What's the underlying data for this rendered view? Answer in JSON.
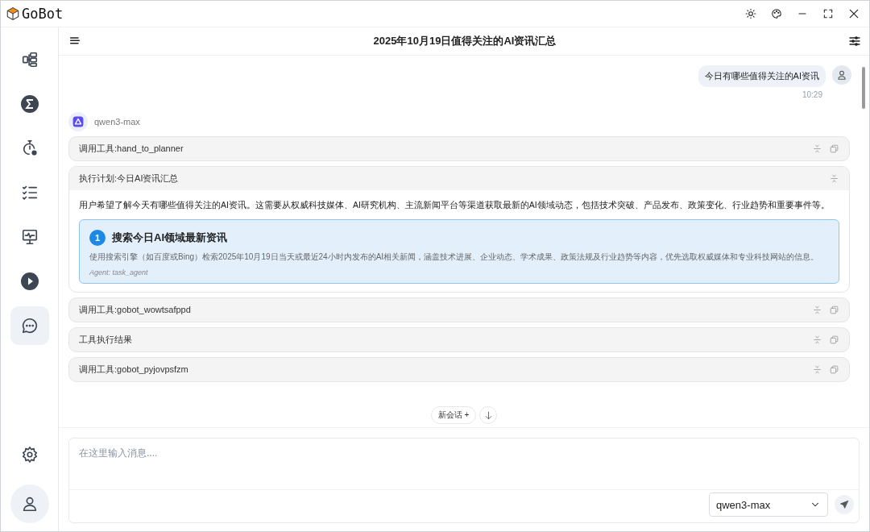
{
  "window": {
    "title": "GoBot"
  },
  "sidebar": {
    "items": [
      {
        "selected": false
      },
      {
        "selected": false
      },
      {
        "selected": false
      },
      {
        "selected": false
      },
      {
        "selected": false
      },
      {
        "selected": false
      },
      {
        "selected": true
      }
    ]
  },
  "header": {
    "title": "2025年10月19日值得关注的AI资讯汇总"
  },
  "user_message": {
    "text": "今日有哪些值得关注的AI资讯",
    "time": "10:29"
  },
  "assistant": {
    "model": "qwen3-max",
    "blocks": [
      {
        "kind": "tool",
        "title": "调用工具:hand_to_planner"
      },
      {
        "kind": "plan",
        "title": "执行计划:今日AI资讯汇总",
        "summary": "用户希望了解今天有哪些值得关注的AI资讯。这需要从权威科技媒体、AI研究机构、主流新闻平台等渠道获取最新的AI领域动态，包括技术突破、产品发布、政策变化、行业趋势和重要事件等。",
        "steps": [
          {
            "number": "1",
            "title": "搜索今日AI领域最新资讯",
            "description": "使用搜索引擎（如百度或Bing）检索2025年10月19日当天或最近24小时内发布的AI相关新闻，涵盖技术进展、企业动态、学术成果、政策法规及行业趋势等内容，优先选取权威媒体和专业科技网站的信息。",
            "agent": "Agent: task_agent"
          }
        ]
      },
      {
        "kind": "tool",
        "title": "调用工具:gobot_wowtsafppd"
      },
      {
        "kind": "tool",
        "title": "工具执行结果"
      },
      {
        "kind": "tool",
        "title": "调用工具:gobot_pyjovpsfzm"
      }
    ]
  },
  "new_chat_button": "新会话 +",
  "composer": {
    "placeholder": "在这里输入消息....",
    "model": "qwen3-max"
  }
}
